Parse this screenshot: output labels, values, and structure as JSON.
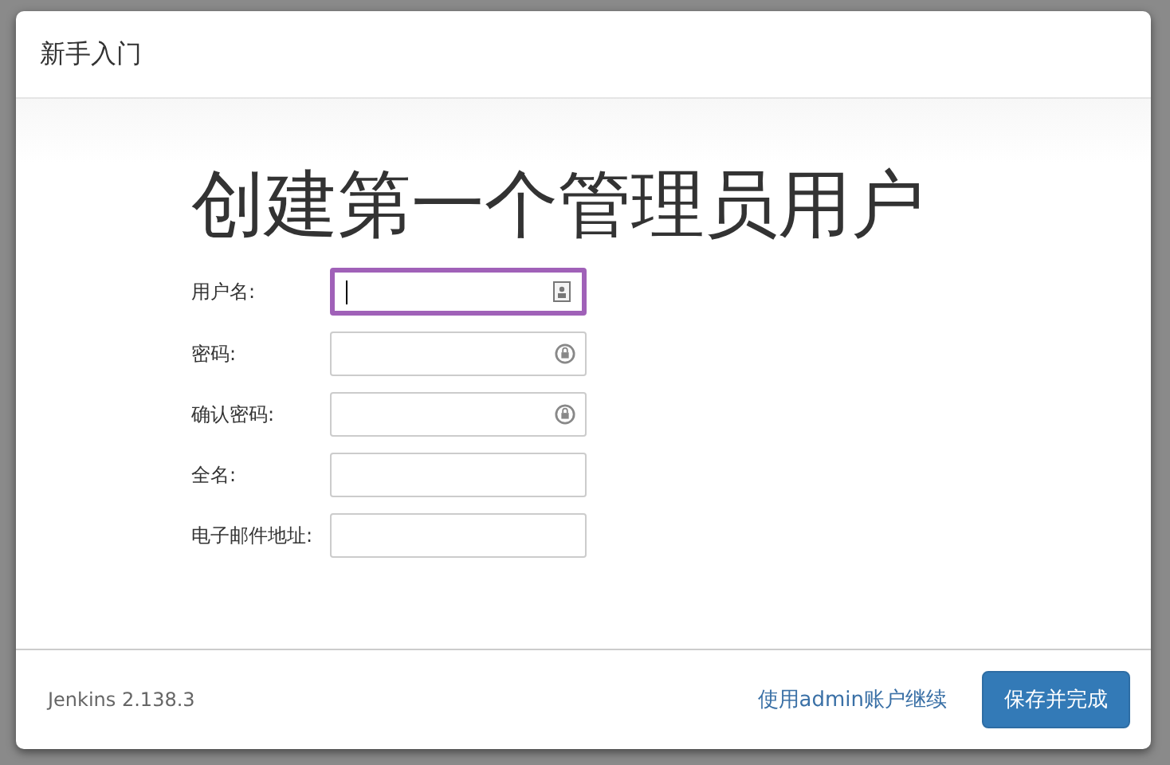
{
  "dialog": {
    "title": "新手入门"
  },
  "heading": "创建第一个管理员用户",
  "fields": [
    {
      "label": "用户名:",
      "kind": "contact",
      "focused": true
    },
    {
      "label": "密码:",
      "kind": "key",
      "focused": false
    },
    {
      "label": "确认密码:",
      "kind": "key",
      "focused": false
    },
    {
      "label": "全名:",
      "kind": "plain",
      "focused": false
    },
    {
      "label": "电子邮件地址:",
      "kind": "plain",
      "focused": false
    }
  ],
  "footer": {
    "version": "Jenkins 2.138.3",
    "link": "使用admin账户继续",
    "button": "保存并完成"
  }
}
